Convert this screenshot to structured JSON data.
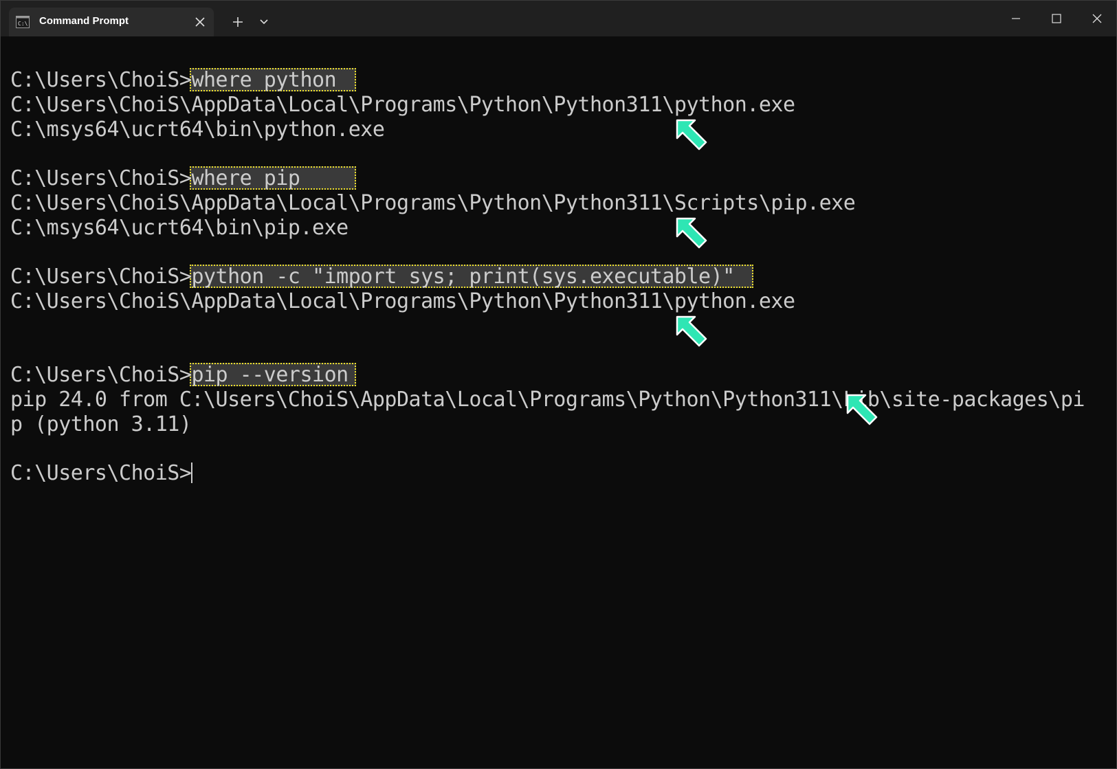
{
  "window": {
    "tab_title": "Command Prompt",
    "icons": {
      "tab": "command-prompt-icon",
      "close_tab": "close-icon",
      "new_tab": "plus-icon",
      "dropdown": "chevron-down-icon",
      "minimize": "minimize-icon",
      "maximize": "maximize-icon",
      "close_window": "close-icon"
    }
  },
  "terminal": {
    "prompt": "C:\\Users\\ChoiS>",
    "blocks": [
      {
        "command": "where python",
        "output": [
          "C:\\Users\\ChoiS\\AppData\\Local\\Programs\\Python\\Python311\\python.exe",
          "C:\\msys64\\ucrt64\\bin\\python.exe"
        ]
      },
      {
        "command": "where pip",
        "output": [
          "C:\\Users\\ChoiS\\AppData\\Local\\Programs\\Python\\Python311\\Scripts\\pip.exe",
          "C:\\msys64\\ucrt64\\bin\\pip.exe"
        ]
      },
      {
        "command": "python -c \"import sys; print(sys.executable)\"",
        "output": [
          "C:\\Users\\ChoiS\\AppData\\Local\\Programs\\Python\\Python311\\python.exe"
        ]
      },
      {
        "command": "pip --version",
        "output": [
          "pip 24.0 from C:\\Users\\ChoiS\\AppData\\Local\\Programs\\Python\\Python311\\Lib\\site-packages\\pi",
          "p (python 3.11)"
        ]
      }
    ],
    "final_prompt": "C:\\Users\\ChoiS>"
  },
  "colors": {
    "background": "#0c0c0c",
    "text": "#cccccc",
    "highlight_border": "#f0e22c",
    "annotation_arrow": "#2ee6b4"
  },
  "annotations": {
    "arrow_icon": "arrow-up-left-icon"
  }
}
